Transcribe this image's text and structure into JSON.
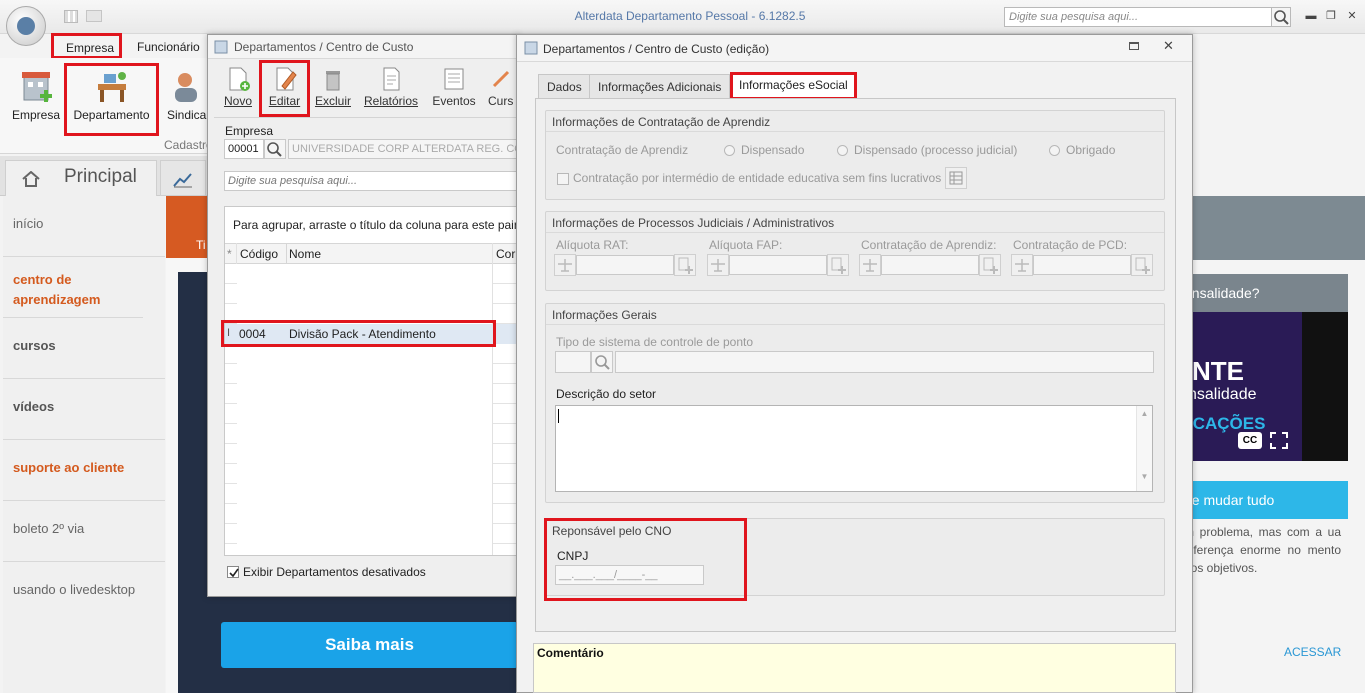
{
  "app": {
    "title": "Alterdata Departamento Pessoal - 6.1282.5",
    "search_placeholder": "Digite sua pesquisa aqui..."
  },
  "menu": [
    {
      "label": "Empresa"
    },
    {
      "label": "Funcionário"
    }
  ],
  "ribbon": {
    "buttons": [
      {
        "label": "Empresa"
      },
      {
        "label": "Departamento"
      },
      {
        "label": "Sindica"
      }
    ],
    "group_label": "Cadastro"
  },
  "hometabs": {
    "principal": "Principal"
  },
  "leftnav": {
    "items": [
      {
        "label": "início"
      },
      {
        "label": "centro de aprendizagem"
      },
      {
        "label": "cursos"
      },
      {
        "label": "vídeos"
      },
      {
        "label": "suporte ao cliente"
      },
      {
        "label": "boleto 2º via"
      },
      {
        "label": "usando o livedesktop"
      }
    ]
  },
  "promo": {
    "banner_fragment": "Ti",
    "button": "Saiba mais"
  },
  "right_panel": {
    "question": "ensalidade?",
    "video_title": "NTE",
    "video_sub": "nsalidade",
    "video_sub2": "ICAÇÕES",
    "cc": "CC",
    "link_title": "de mudar tudo",
    "text": "m problema, mas com a ua diferença enorme no mento dos objetivos.",
    "access": "ACESSAR"
  },
  "dept_window": {
    "title": "Departamentos / Centro de Custo",
    "toolbar": [
      {
        "label": "Novo"
      },
      {
        "label": "Editar"
      },
      {
        "label": "Excluir"
      },
      {
        "label": "Relatórios"
      },
      {
        "label": "Eventos"
      },
      {
        "label": "Curs"
      }
    ],
    "empresa_label": "Empresa",
    "empresa_code": "00001",
    "empresa_name": "UNIVERSIDADE CORP ALTERDATA REG. CO",
    "search_placeholder": "Digite sua pesquisa aqui...",
    "group_hint": "Para agrupar, arraste o título da coluna para este paine",
    "columns": [
      "*",
      "Código",
      "Nome",
      "Cor"
    ],
    "row": {
      "code": "0004",
      "name": "Divisão Pack - Atendimento"
    },
    "show_inactive": "Exibir Departamentos desativados"
  },
  "edit_window": {
    "title": "Departamentos / Centro de Custo (edição)",
    "tabs": [
      {
        "label": "Dados"
      },
      {
        "label": "Informações Adicionais"
      },
      {
        "label": "Informações eSocial"
      }
    ],
    "aprendiz": {
      "title": "Informações de Contratação de Aprendiz",
      "label": "Contratação de Aprendiz",
      "options": [
        "Dispensado",
        "Dispensado (processo judicial)",
        "Obrigado"
      ],
      "checkbox": "Contratação por intermédio de entidade educativa sem fins lucrativos"
    },
    "processos": {
      "title": "Informações de Processos Judiciais / Administrativos",
      "fields": [
        "Alíquota RAT:",
        "Alíquota FAP:",
        "Contratação de Aprendiz:",
        "Contratação de PCD:"
      ]
    },
    "gerais": {
      "title": "Informações Gerais",
      "ponto": "Tipo de sistema de controle de ponto",
      "descricao": "Descrição do setor"
    },
    "cno": {
      "title": "Reponsável pelo CNO",
      "label": "CNPJ",
      "mask": "__.___.___/____-__"
    },
    "comentario": "Comentário"
  },
  "colors": {
    "highlight": "#e0151d",
    "orange": "#d45a1e",
    "navy": "#232f45",
    "blue_button": "#1aa3e8",
    "teal": "#2db7e8"
  }
}
